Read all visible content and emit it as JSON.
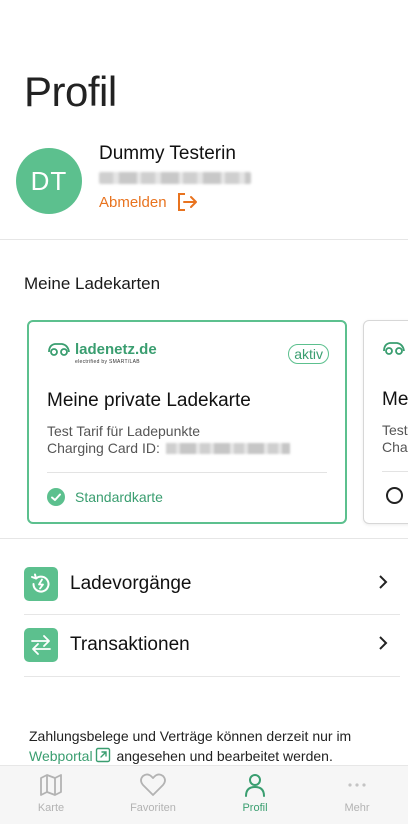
{
  "page": {
    "title": "Profil"
  },
  "user": {
    "initials": "DT",
    "name": "Dummy Testerin",
    "logout_label": "Abmelden"
  },
  "cards_section": {
    "title": "Meine Ladekarten"
  },
  "cards": [
    {
      "brand": "ladenetz.de",
      "brand_sub": "electrified by SMART/LAB",
      "badge": "aktiv",
      "title": "Meine private Ladekarte",
      "tariff": "Test Tarif für Ladepunkte",
      "id_label": "Charging Card ID:",
      "default_label": "Standardkarte"
    },
    {
      "title": "Me",
      "tariff": "Test",
      "id_label": "Cha"
    }
  ],
  "menu": {
    "charging": "Ladevorgänge",
    "transactions": "Transaktionen"
  },
  "info": {
    "before": "Zahlungsbelege und Verträge können derzeit nur im",
    "link": "Webportal",
    "after": " angesehen und bearbeitet werden."
  },
  "nav": [
    {
      "label": "Karte",
      "icon": "map-icon"
    },
    {
      "label": "Favoriten",
      "icon": "heart-icon"
    },
    {
      "label": "Profil",
      "icon": "person-icon",
      "active": true
    },
    {
      "label": "Mehr",
      "icon": "more-icon"
    }
  ],
  "colors": {
    "accent": "#5cc08e",
    "accent_text": "#3a9e70",
    "logout": "#e8731f"
  }
}
